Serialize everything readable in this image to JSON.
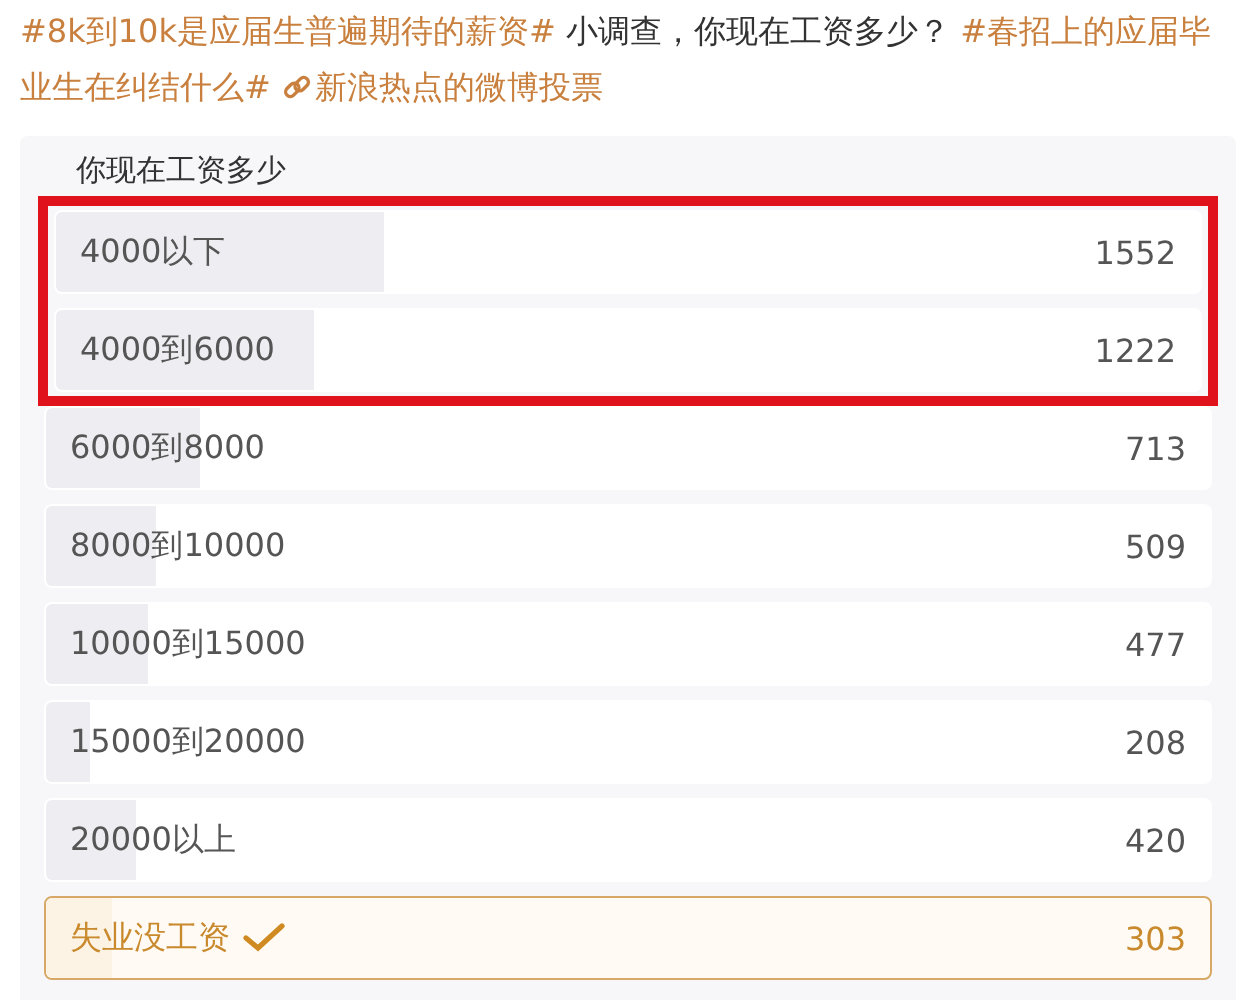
{
  "post": {
    "segments": [
      {
        "kind": "hashtag",
        "text": "#8k到10k是应届生普遍期待的薪资#"
      },
      {
        "kind": "text",
        "text": "小调查，你现在工资多少？"
      },
      {
        "kind": "hashtag",
        "text": "#春招上的应届毕业生在纠结什么#"
      },
      {
        "kind": "link",
        "text": "新浪热点的微博投票"
      }
    ]
  },
  "poll": {
    "title": "你现在工资多少",
    "options": [
      {
        "label": "4000以下",
        "count": "1552",
        "level": 0.287,
        "selected": false,
        "highlighted": true
      },
      {
        "label": "4000到6000",
        "count": "1222",
        "level": 0.226,
        "selected": false,
        "highlighted": true
      },
      {
        "label": "6000到8000",
        "count": "713",
        "level": 0.132,
        "selected": false,
        "highlighted": false
      },
      {
        "label": "8000到10000",
        "count": "509",
        "level": 0.094,
        "selected": false,
        "highlighted": false
      },
      {
        "label": "10000到15000",
        "count": "477",
        "level": 0.088,
        "selected": false,
        "highlighted": false
      },
      {
        "label": "15000到20000",
        "count": "208",
        "level": 0.038,
        "selected": false,
        "highlighted": false
      },
      {
        "label": "20000以上",
        "count": "420",
        "level": 0.078,
        "selected": false,
        "highlighted": false
      },
      {
        "label": "失业没工资",
        "count": "303",
        "level": 0.056,
        "selected": true,
        "highlighted": false
      }
    ]
  }
}
